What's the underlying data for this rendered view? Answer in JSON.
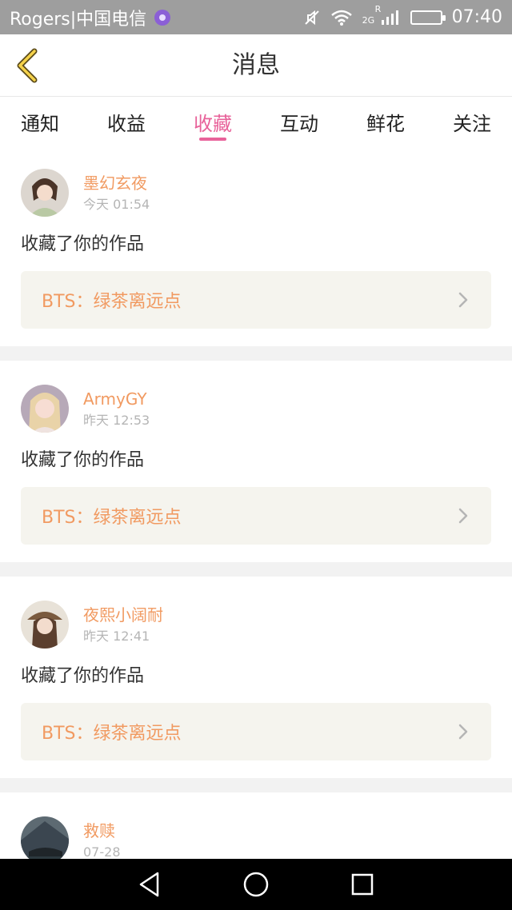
{
  "status_bar": {
    "carrier": "Rogers|中国电信",
    "network": "2G",
    "roaming": "R",
    "time": "07:40"
  },
  "header": {
    "title": "消息",
    "back_icon": "chevron-left-icon"
  },
  "tabs": [
    {
      "label": "通知",
      "active": false
    },
    {
      "label": "收益",
      "active": false
    },
    {
      "label": "收藏",
      "active": true
    },
    {
      "label": "互动",
      "active": false
    },
    {
      "label": "鲜花",
      "active": false
    },
    {
      "label": "关注",
      "active": false
    }
  ],
  "colors": {
    "accent": "#e8629a",
    "username": "#f19a61",
    "work_title": "#f19a61",
    "work_bg": "#f5f4ee"
  },
  "messages": [
    {
      "username": "墨幻玄夜",
      "time": "今天 01:54",
      "action": "收藏了你的作品",
      "work": "BTS：绿茶离远点"
    },
    {
      "username": "ArmyGY",
      "time": "昨天 12:53",
      "action": "收藏了你的作品",
      "work": "BTS：绿茶离远点"
    },
    {
      "username": "夜熙小阔耐",
      "time": "昨天 12:41",
      "action": "收藏了你的作品",
      "work": "BTS：绿茶离远点"
    },
    {
      "username": "救赎",
      "time": "07-28"
    }
  ],
  "nav": {
    "back": "triangle-back-icon",
    "home": "circle-home-icon",
    "recent": "square-recent-icon"
  }
}
